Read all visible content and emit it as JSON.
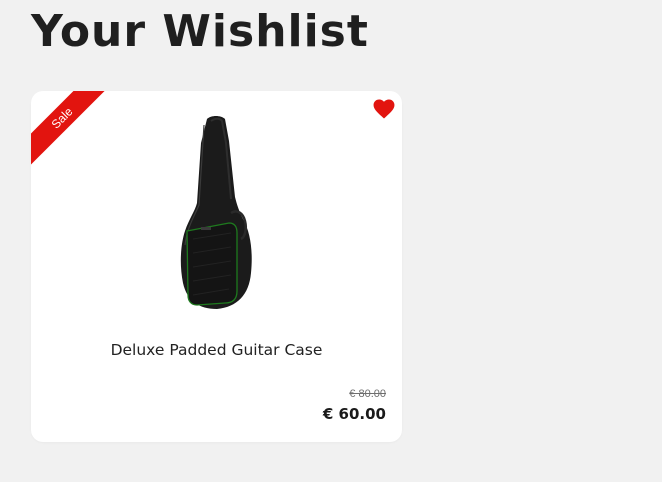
{
  "page": {
    "title": "Your Wishlist"
  },
  "wishlist": {
    "items": [
      {
        "badge": "Sale",
        "name": "Deluxe Padded Guitar Case",
        "old_price": "€ 80.00",
        "price": "€ 60.00",
        "image_icon": "guitar-case-image",
        "favorite_icon": "heart-icon",
        "favorited": true
      }
    ]
  },
  "colors": {
    "background": "#f1f1f1",
    "card": "#ffffff",
    "accent_red": "#e2140f",
    "text": "#1f1f1f"
  }
}
